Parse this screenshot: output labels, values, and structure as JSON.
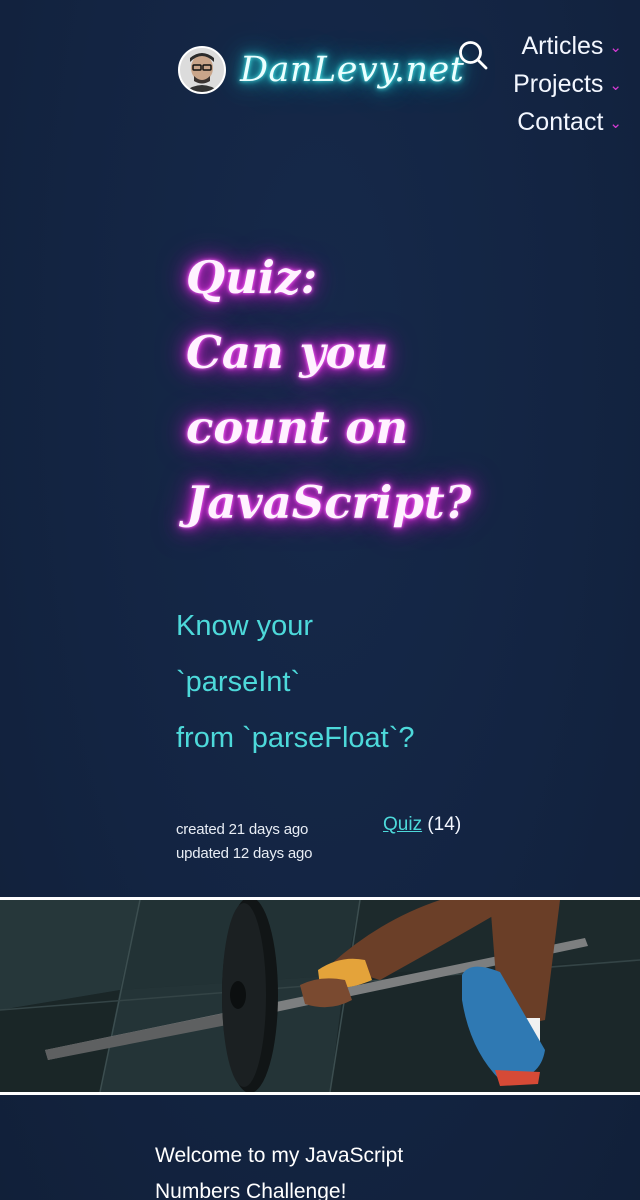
{
  "site": {
    "name": "DanLevy.net"
  },
  "nav": {
    "items": [
      {
        "label": "Articles",
        "caret": "⌄"
      },
      {
        "label": "Projects",
        "caret": "⌄"
      },
      {
        "label": "Contact",
        "caret": "⌄"
      }
    ]
  },
  "icons": {
    "search": "search-icon",
    "caret": "chevron-down-icon"
  },
  "colors": {
    "background": "#142540",
    "brand_glow": "#27d8e0",
    "title_glow": "#e833e6",
    "accent_teal": "#4dd9da",
    "caret": "#d63ad3"
  },
  "article": {
    "title_lines": [
      "Quiz:",
      "Can you",
      "count on",
      "JavaScript?"
    ],
    "subtitle_lines": [
      "Know your",
      "`parseInt`",
      "from `parseFloat`?"
    ],
    "created": "created 21 days ago",
    "updated": "updated 12 days ago",
    "tag": {
      "label": "Quiz",
      "count": "(14)"
    },
    "intro_lines": [
      "Welcome to my JavaScript",
      "Numbers Challenge!"
    ]
  }
}
